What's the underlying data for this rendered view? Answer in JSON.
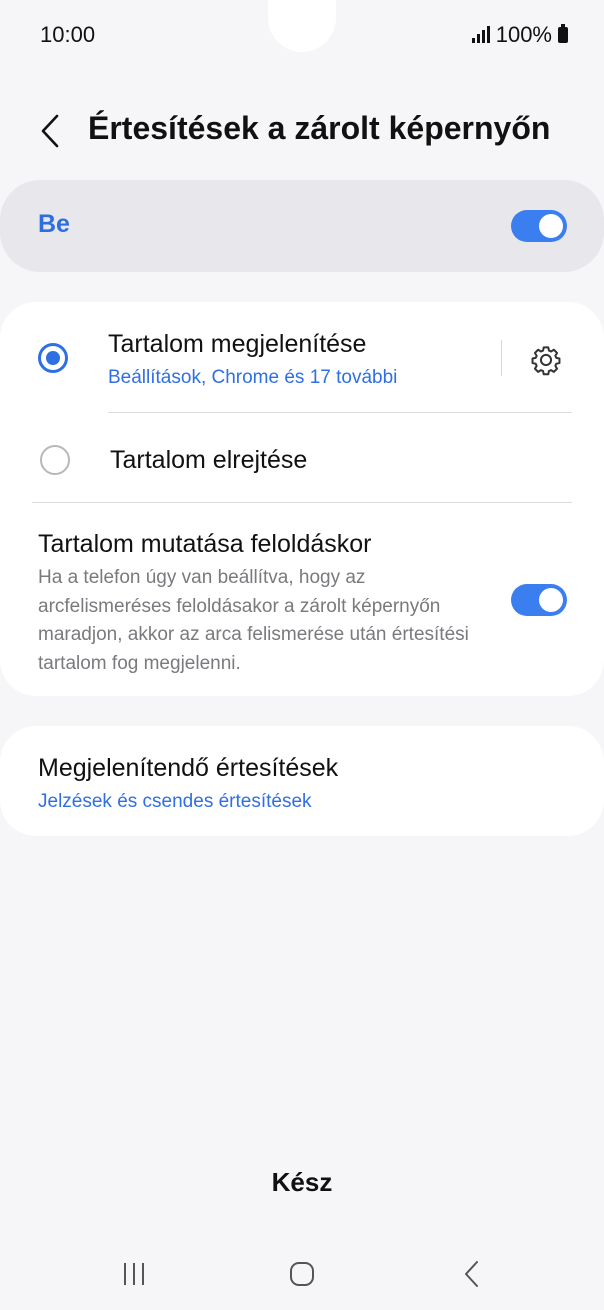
{
  "status_bar": {
    "time": "10:00",
    "battery": "100%"
  },
  "header": {
    "title": "Értesítések a zárolt képernyőn"
  },
  "master": {
    "label": "Be",
    "enabled": true
  },
  "options": {
    "show_content": {
      "title": "Tartalom megjelenítése",
      "subtitle": "Beállítások, Chrome és 17 további",
      "selected": true
    },
    "hide_content": {
      "title": "Tartalom elrejtése",
      "selected": false
    },
    "unlock_show": {
      "title": "Tartalom mutatása feloldáskor",
      "description": "Ha a telefon úgy van beállítva, hogy az arcfelismeréses feloldásakor a zárolt képernyőn maradjon, akkor az arca felismerése után értesítési tartalom fog megjelenni.",
      "enabled": true
    }
  },
  "notifications_to_show": {
    "title": "Megjelenítendő értesítések",
    "subtitle": "Jelzések és csendes értesítések"
  },
  "done_button": "Kész",
  "colors": {
    "accent": "#2f6fe4",
    "toggle_on": "#3b7ef0",
    "background": "#f6f6f8",
    "card": "#ffffff",
    "master_card": "#e8e8ec",
    "secondary_text": "#7a7a7e"
  },
  "icons": [
    "back-chevron-icon",
    "gear-icon",
    "signal-icon",
    "battery-icon",
    "recents-icon",
    "home-icon",
    "nav-back-icon"
  ]
}
